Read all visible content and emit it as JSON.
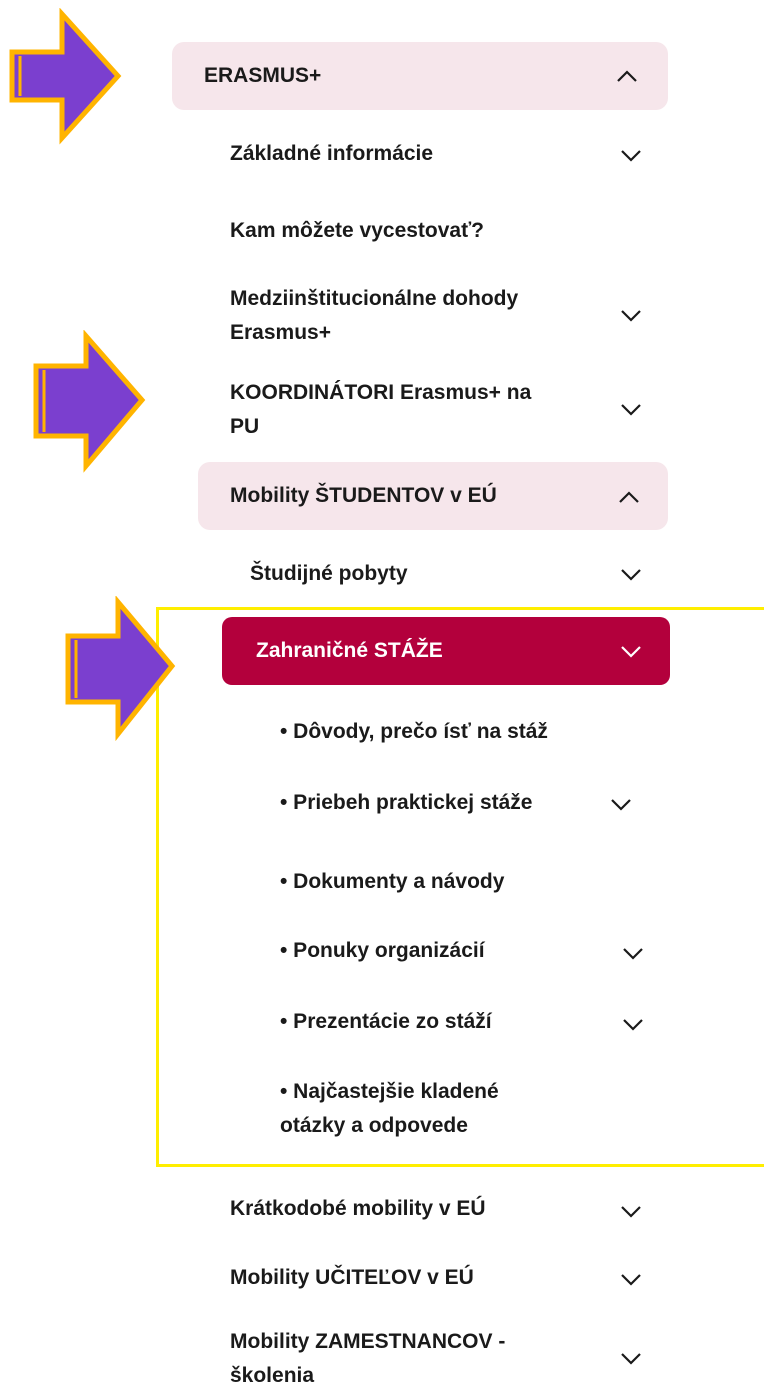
{
  "colors": {
    "highlight_pink": "#f6e6eb",
    "active_red": "#b3003c",
    "arrow_fill": "#7b3fcf",
    "arrow_stroke": "#ffb400",
    "frame": "#ffee00"
  },
  "menu": {
    "erasmus": "ERASMUS+",
    "zakladne": "Základné informácie",
    "kam": "Kam môžete vycestovať?",
    "medzi": "Medziinštitucionálne dohody\nErasmus+",
    "koord": "KOORDINÁTORI Erasmus+ na\nPU",
    "mobility_studentov": "Mobility ŠTUDENTOV v EÚ",
    "studijne": "Študijné pobyty",
    "zahranicne": "Zahraničné STÁŽE",
    "dovody": "• Dôvody, prečo ísť na stáž",
    "priebeh": "• Priebeh praktickej stáže",
    "dokumenty": "• Dokumenty a návody",
    "ponuky": "• Ponuky organizácií",
    "prezentacie": "• Prezentácie zo stáží",
    "najcastejsie": "• Najčastejšie kladené\notázky a odpovede",
    "kratkodobe": "Krátkodobé mobility v EÚ",
    "ucitelov": "Mobility UČITEĽOV v EÚ",
    "zamestnancov": "Mobility ZAMESTNANCOV -\nškolenia"
  },
  "icons": {
    "chevron_up": "chevron-up-icon",
    "chevron_down": "chevron-down-icon",
    "arrow": "right-arrow-icon"
  }
}
